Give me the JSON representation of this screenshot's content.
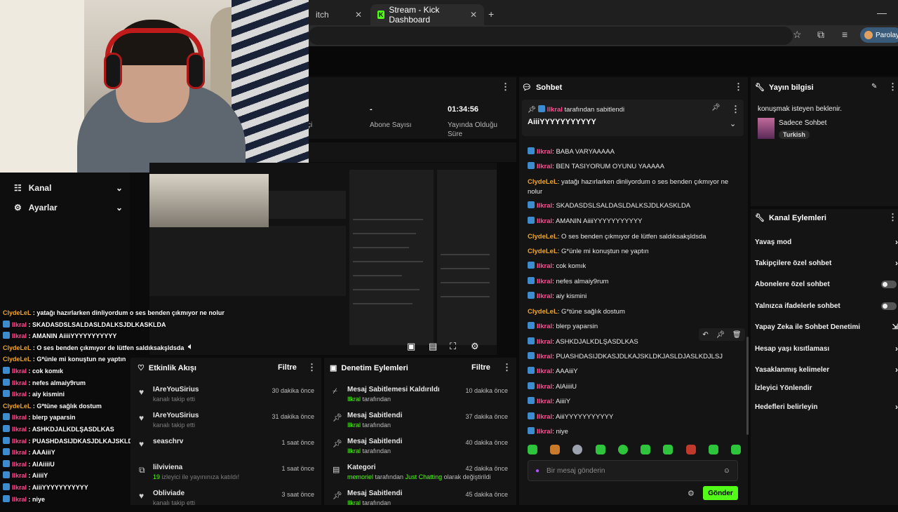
{
  "browser": {
    "tabs": [
      {
        "label": "itch"
      },
      {
        "label": "Stream - Kick Dashboard"
      }
    ],
    "profile_label": "Parolayı"
  },
  "sidebar": {
    "items": [
      {
        "label": "Kanal"
      },
      {
        "label": "Ayarlar"
      }
    ]
  },
  "stats": {
    "partial_label": "çi",
    "subs_value": "-",
    "subs_label": "Abone Sayısı",
    "time_value": "01:34:56",
    "time_label_1": "Yayında Olduğu",
    "time_label_2": "Süre"
  },
  "activity": {
    "title": "Etkinlik Akışı",
    "filter_label": "Filtre",
    "rows": [
      {
        "name": "IAreYouSirius",
        "sub": "kanalı takip etti",
        "time": "30 dakika önce"
      },
      {
        "name": "IAreYouSirius",
        "sub": "kanalı takip etti",
        "time": "31 dakika önce"
      },
      {
        "name": "seaschrv",
        "sub": "",
        "time": "1 saat önce"
      },
      {
        "name": "lilviviena",
        "sub_count": "19",
        "sub": "izleyici ile yayınınıza katıldı!",
        "time": "1 saat önce"
      },
      {
        "name": "Obliviade",
        "sub": "kanalı takip etti",
        "time": "3 saat önce"
      }
    ]
  },
  "modlog": {
    "title": "Denetim Eylemleri",
    "filter_label": "Filtre",
    "rows": [
      {
        "title": "Mesaj Sabitlemesi Kaldırıldı",
        "by": "Ilkral",
        "suffix": "tarafından",
        "time": "10 dakika önce"
      },
      {
        "title": "Mesaj Sabitlendi",
        "by": "Ilkral",
        "suffix": "tarafından",
        "time": "37 dakika önce"
      },
      {
        "title": "Mesaj Sabitlendi",
        "by": "Ilkral",
        "suffix": "tarafından",
        "time": "40 dakika önce"
      },
      {
        "title": "Kategori",
        "by": "memoriel",
        "suffix": "tarafından",
        "category": "Just Chatting",
        "suffix2": "olarak değiştirildi",
        "time": "42 dakika önce"
      },
      {
        "title": "Mesaj Sabitlendi",
        "by": "Ilkral",
        "suffix": "tarafından",
        "time": "45 dakika önce"
      }
    ]
  },
  "chat": {
    "title": "Sohbet",
    "pinned": {
      "by": "Ilkral",
      "label": "tarafından sabitlendi",
      "text": "AiiiYYYYYYYYYYY"
    },
    "messages": [
      {
        "user": "Ilkral",
        "text": "BABA VARYAAAAA"
      },
      {
        "user": "Ilkral",
        "text": "BEN TASIYORUM OYUNU YAAAAA"
      },
      {
        "user": "ClydeLeL",
        "text": "yatağı hazırlarken dinliyordum o ses benden çıkmıyor ne nolur"
      },
      {
        "user": "Ilkral",
        "text": "SKADASDSLSALDASLDALKSJDLKASKLDA"
      },
      {
        "user": "Ilkral",
        "text": "AMANIN AiiiiYYYYYYYYYYY"
      },
      {
        "user": "ClydeLeL",
        "text": "O ses benden çıkmıyor de lütfen saldıksakşldsda"
      },
      {
        "user": "ClydeLeL",
        "text": "G*ünle mi konuştun ne yaptın"
      },
      {
        "user": "Ilkral",
        "text": "cok komık"
      },
      {
        "user": "Ilkral",
        "text": "nefes almaiy9rum"
      },
      {
        "user": "Ilkral",
        "text": "aiy kismini"
      },
      {
        "user": "ClydeLeL",
        "text": "G*tüne sağlık dostum"
      },
      {
        "user": "Ilkral",
        "text": "blerp yaparsin"
      },
      {
        "user": "Ilkral",
        "text": "ASHKDJALKDLŞASDLKAS"
      },
      {
        "user": "Ilkral",
        "text": "PUASHDASIJDKASJDLKAJSKLDKJASLDJASLKDJLSJ"
      },
      {
        "user": "Ilkral",
        "text": "AAAiiiY"
      },
      {
        "user": "Ilkral",
        "text": "AlAiiiiU"
      },
      {
        "user": "Ilkral",
        "text": "AiiiiY"
      },
      {
        "user": "Ilkral",
        "text": "AiiiYYYYYYYYYYY"
      },
      {
        "user": "Ilkral",
        "text": "niye"
      }
    ],
    "input_placeholder": "Bir mesaj gönderin",
    "send_label": "Gönder"
  },
  "info": {
    "title": "Yayın bilgisi",
    "stream_title": "konuşmak isteyen beklenir.",
    "category": "Sadece Sohbet",
    "language": "Turkish"
  },
  "actions": {
    "title": "Kanal Eylemleri",
    "items": [
      {
        "label": "Yavaş mod"
      },
      {
        "label": "Takipçilere özel sohbet"
      },
      {
        "label": "Abonelere özel sohbet"
      },
      {
        "label": "Yalnızca ifadelerle sohbet"
      },
      {
        "label": "Yapay Zeka ile Sohbet Denetimi"
      },
      {
        "label": "Hesap yaşı kısıtlaması"
      },
      {
        "label": "Yasaklanmış kelimeler"
      },
      {
        "label": "İzleyici Yönlendir"
      },
      {
        "label": "Hedefleri belirleyin"
      }
    ]
  },
  "overlay": {
    "lines": [
      {
        "user": "ClydeLeL",
        "text": "yatağı hazırlarken dinliyordum o ses benden çıkmıyor ne nolur"
      },
      {
        "user": "Ilkral",
        "text": "SKADASDSLSALDASLDALKSJDLKASKLDA"
      },
      {
        "user": "Ilkral",
        "text": "AMANIN AiiiiYYYYYYYYYYY"
      },
      {
        "user": "ClydeLeL",
        "text": "O ses benden çıkmıyor de lütfen saldıksakşldsda"
      },
      {
        "user": "ClydeLeL",
        "text": "G*ünle mi konuştun ne yaptın"
      },
      {
        "user": "Ilkral",
        "text": "cok komık"
      },
      {
        "user": "Ilkral",
        "text": "nefes almaiy9rum"
      },
      {
        "user": "Ilkral",
        "text": "aiy kismini"
      },
      {
        "user": "ClydeLeL",
        "text": "G*tüne sağlık dostum"
      },
      {
        "user": "Ilkral",
        "text": "blerp yaparsin"
      },
      {
        "user": "Ilkral",
        "text": "ASHKDJALKDLŞASDLKAS"
      },
      {
        "user": "Ilkral",
        "text": "PUASHDASIJDKASJDLKAJSKLDKJASLDJASLKDJLSJ"
      },
      {
        "user": "Ilkral",
        "text": "AAAiiiY"
      },
      {
        "user": "Ilkral",
        "text": "AlAiiiiU"
      },
      {
        "user": "Ilkral",
        "text": "AiiiiY"
      },
      {
        "user": "Ilkral",
        "text": "AiiiYYYYYYYYYYY"
      },
      {
        "user": "Ilkral",
        "text": "niye"
      }
    ]
  },
  "colors": {
    "accent": "#53fc18",
    "user_ilkral": "#ff4d91",
    "user_clyde": "#f5a623"
  }
}
